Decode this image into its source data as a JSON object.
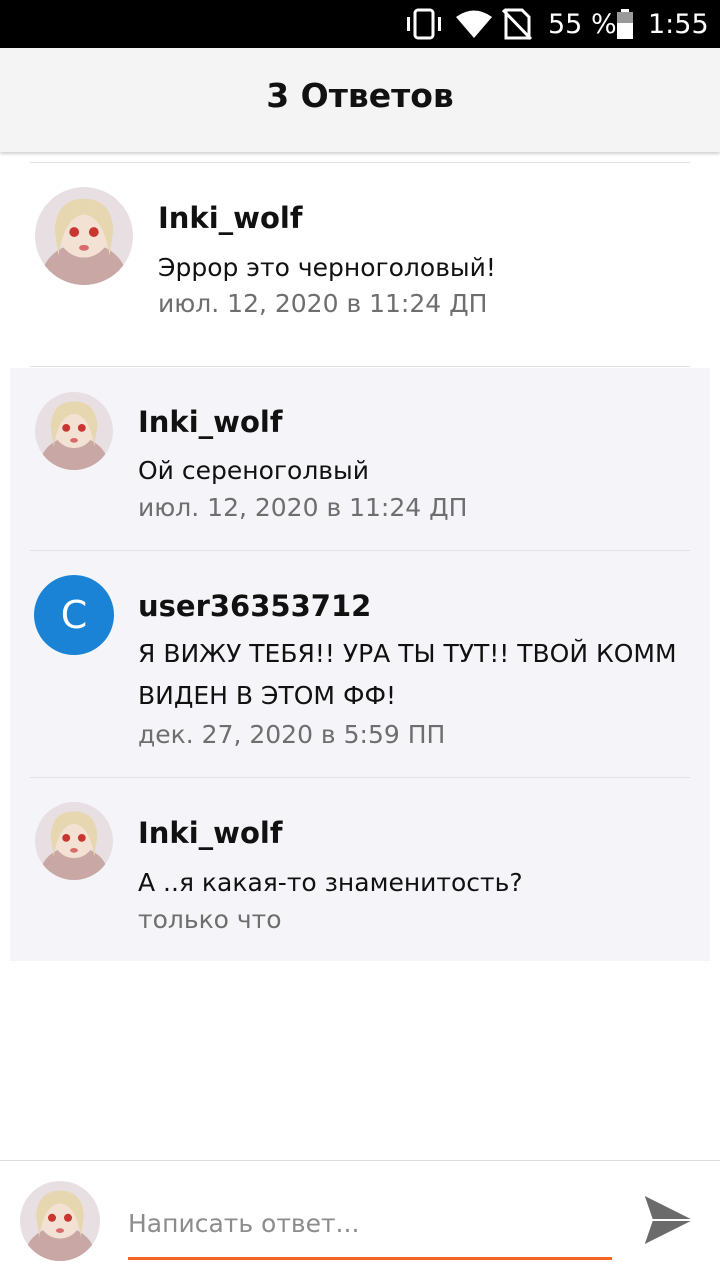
{
  "status_bar": {
    "battery": "55 %",
    "time": "1:55",
    "icons": [
      "vibrate-icon",
      "wifi-icon",
      "no-sim-icon",
      "battery-icon"
    ]
  },
  "header": {
    "title": "3 Ответов"
  },
  "parent_comment": {
    "author": "Inki_wolf",
    "text": "Эррор это черноголовый!",
    "date": "июл. 12, 2020 в 11:24 ДП"
  },
  "replies": [
    {
      "author": "Inki_wolf",
      "text": "Ой сереноголвый",
      "date": "июл. 12, 2020 в 11:24 ДП"
    },
    {
      "author": "user36353712",
      "avatar_letter": "C",
      "text": "Я ВИЖУ ТЕБЯ!! УРА ТЫ ТУТ!! ТВОЙ КОММ ВИДЕН В ЭТОМ ФФ!",
      "date": "дек. 27, 2020 в 5:59 ПП"
    },
    {
      "author": "Inki_wolf",
      "text": "А ..я какая-то знаменитость?",
      "date": "только что"
    }
  ],
  "composer": {
    "placeholder": "Написать ответ..."
  },
  "colors": {
    "accent": "#f26522",
    "letter_avatar": "#1a83d6",
    "reply_background": "#f5f4f8",
    "send_icon": "#6b6b6b"
  }
}
